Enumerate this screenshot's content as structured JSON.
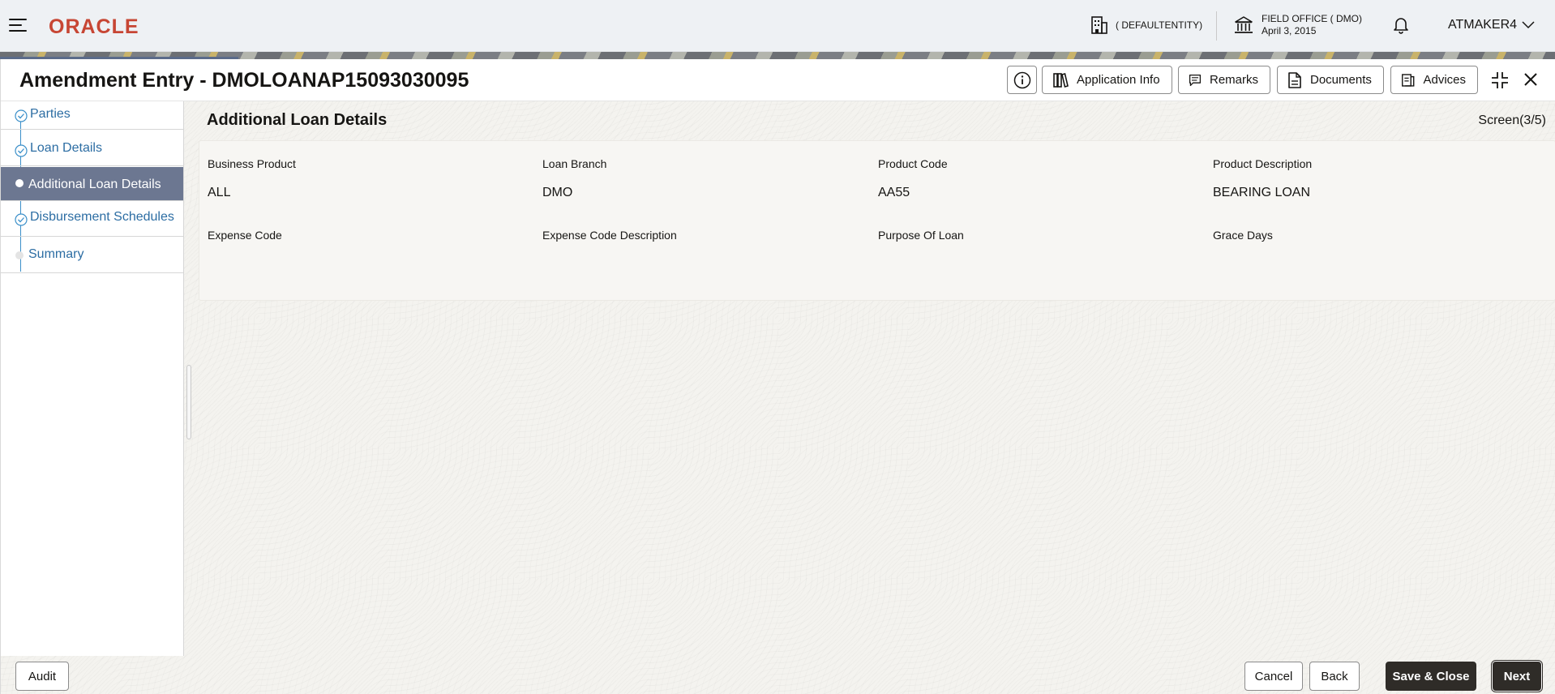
{
  "topbar": {
    "logo": "ORACLE",
    "entity": "( DEFAULTENTITY)",
    "office_name": "FIELD OFFICE ( DMO)",
    "office_date": "April 3, 2015",
    "user": "ATMAKER4"
  },
  "window": {
    "title": "Amendment Entry - DMOLOANAP15093030095",
    "buttons": {
      "application_info": "Application Info",
      "remarks": "Remarks",
      "documents": "Documents",
      "advices": "Advices"
    }
  },
  "nav": {
    "items": [
      {
        "label": "Parties",
        "state": "done"
      },
      {
        "label": "Loan Details",
        "state": "done"
      },
      {
        "label": "Additional Loan Details",
        "state": "active"
      },
      {
        "label": "Disbursement Schedules",
        "state": "done"
      },
      {
        "label": "Summary",
        "state": "pending"
      }
    ]
  },
  "content": {
    "section_title": "Additional Loan Details",
    "screen_counter": "Screen(3/5)",
    "fields": {
      "business_product": {
        "label": "Business Product",
        "value": "ALL"
      },
      "loan_branch": {
        "label": "Loan Branch",
        "value": "DMO"
      },
      "product_code": {
        "label": "Product Code",
        "value": "AA55"
      },
      "product_description": {
        "label": "Product Description",
        "value": "BEARING LOAN"
      },
      "expense_code": {
        "label": "Expense Code",
        "value": ""
      },
      "expense_code_description": {
        "label": "Expense Code Description",
        "value": ""
      },
      "purpose_of_loan": {
        "label": "Purpose Of Loan",
        "value": ""
      },
      "grace_days": {
        "label": "Grace Days",
        "value": ""
      }
    }
  },
  "footer": {
    "audit": "Audit",
    "cancel": "Cancel",
    "back": "Back",
    "save_close": "Save & Close",
    "next": "Next"
  },
  "colors": {
    "brand": "#c74634",
    "nav_active": "#6c7791",
    "nav_link": "#2c6da3",
    "nav_check": "#3a8fc9",
    "primary_button": "#2f2c28"
  }
}
